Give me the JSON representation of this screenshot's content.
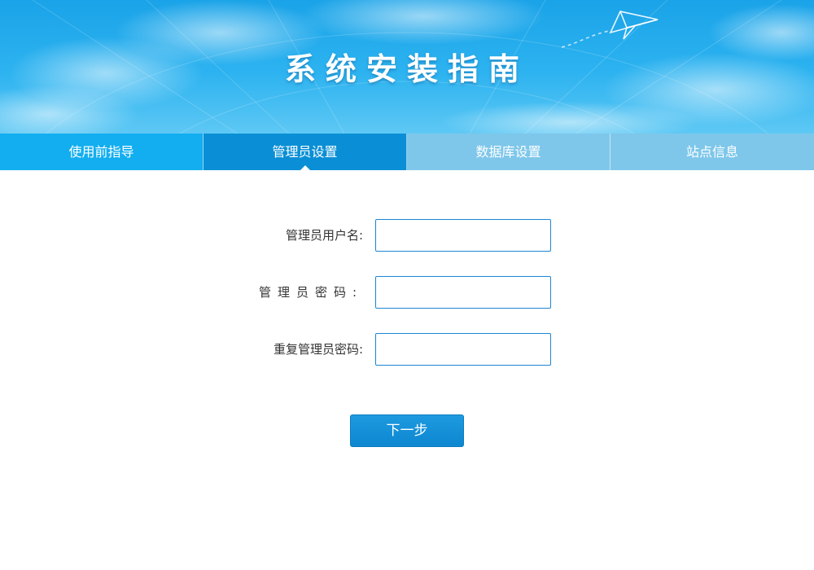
{
  "banner": {
    "title": "系统安装指南"
  },
  "tabs": [
    {
      "label": "使用前指导",
      "state": "done"
    },
    {
      "label": "管理员设置",
      "state": "active"
    },
    {
      "label": "数据库设置",
      "state": "todo"
    },
    {
      "label": "站点信息",
      "state": "todo"
    }
  ],
  "form": {
    "username_label": "管理员用户名:",
    "password_label": "管理员密码:",
    "repeat_password_label": "重复管理员密码:",
    "username_value": "",
    "password_value": "",
    "repeat_password_value": ""
  },
  "actions": {
    "next_label": "下一步"
  },
  "colors": {
    "banner_blue": "#1aa3e8",
    "tab_done": "#12aef0",
    "tab_active": "#0a8fd6",
    "tab_todo": "#7ec7ea",
    "input_border": "#1c86d1",
    "button": "#0d87d0"
  },
  "icons": {
    "banner_decoration": "paper-plane-icon"
  }
}
